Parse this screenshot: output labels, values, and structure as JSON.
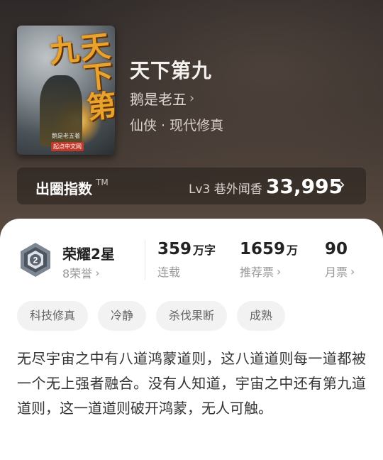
{
  "cover": {
    "title_art": "天下第九",
    "author": "鹅是老五著",
    "publisher": "起点中文网"
  },
  "book": {
    "title": "天下第九",
    "author": "鹅是老五",
    "genre": "仙侠 · 现代修真"
  },
  "index_bar": {
    "label": "出圈指数",
    "tm": "TM",
    "level_text": "Lv3 巷外闻香",
    "value": "33,995"
  },
  "honor": {
    "title": "荣耀2星",
    "subtitle": "8荣誉",
    "badge_number": "2"
  },
  "stats": [
    {
      "num": "359",
      "unit": "万字",
      "label": "连载"
    },
    {
      "num": "1659",
      "unit": "万",
      "label": "推荐票"
    },
    {
      "num": "90",
      "unit": "",
      "label": "月票"
    }
  ],
  "tags": [
    "科技修真",
    "冷静",
    "杀伐果断",
    "成熟"
  ],
  "description": "无尽宇宙之中有八道鸿蒙道则，这八道道则每一道都被一个无上强者融合。没有人知道，宇宙之中还有第九道道则，这一道道则破开鸿蒙，无人可触。"
}
